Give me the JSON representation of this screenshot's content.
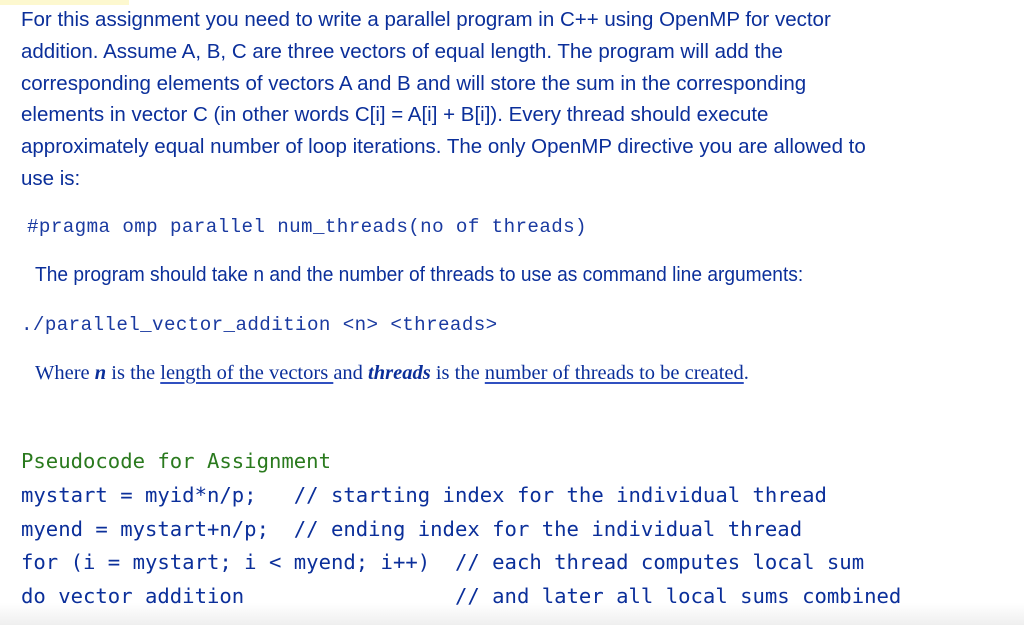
{
  "intro_paragraph": "For this assignment you need to write a parallel program in C++ using OpenMP for vector addition. Assume A, B, C are three vectors of equal length. The program will add the corresponding elements of vectors A and B and will store the sum in the corresponding elements in vector C (in other words C[i] = A[i] + B[i]). Every thread should execute approximately equal number of loop iterations. The only OpenMP directive you are allowed to use is:",
  "intro_lines": [
    "For this assignment you need to write a parallel program in C++ using OpenMP for vector",
    "addition. Assume A, B, C are three vectors of equal length. The program will add the",
    "corresponding elements of vectors A and B and will store the sum in the corresponding",
    "elements in vector C (in other words C[i] = A[i] + B[i]). Every thread should execute",
    "approximately equal number of loop iterations. The only OpenMP directive you are allowed to",
    "use is:"
  ],
  "pragma_directive": "#pragma omp parallel num_threads(no of threads)",
  "args_instruction": "The program should take n and the number of threads to use as command line arguments:",
  "command_line": "./parallel_vector_addition <n> <threads>",
  "where_sentence": {
    "part1": "Where ",
    "n_term": "n",
    "part2": " is the ",
    "link1": "length of the vectors ",
    "part3": "and ",
    "threads_term": "threads",
    "part4": " is the ",
    "link2": "number of threads to be created",
    "part5": "."
  },
  "pseudocode": {
    "title": "Pseudocode for Assignment",
    "lines": [
      "mystart = myid*n/p;   // starting index for the individual thread",
      "myend = mystart+n/p;  // ending index for the individual thread",
      "for (i = mystart; i < myend; i++)  // each thread computes local sum",
      "do vector addition                 // and later all local sums combined"
    ]
  },
  "colors": {
    "body_text": "#0b2f9a",
    "code_text": "#1a3aa0",
    "pseudo_title": "#2a7a1e",
    "highlight": "#fdf8cf"
  }
}
